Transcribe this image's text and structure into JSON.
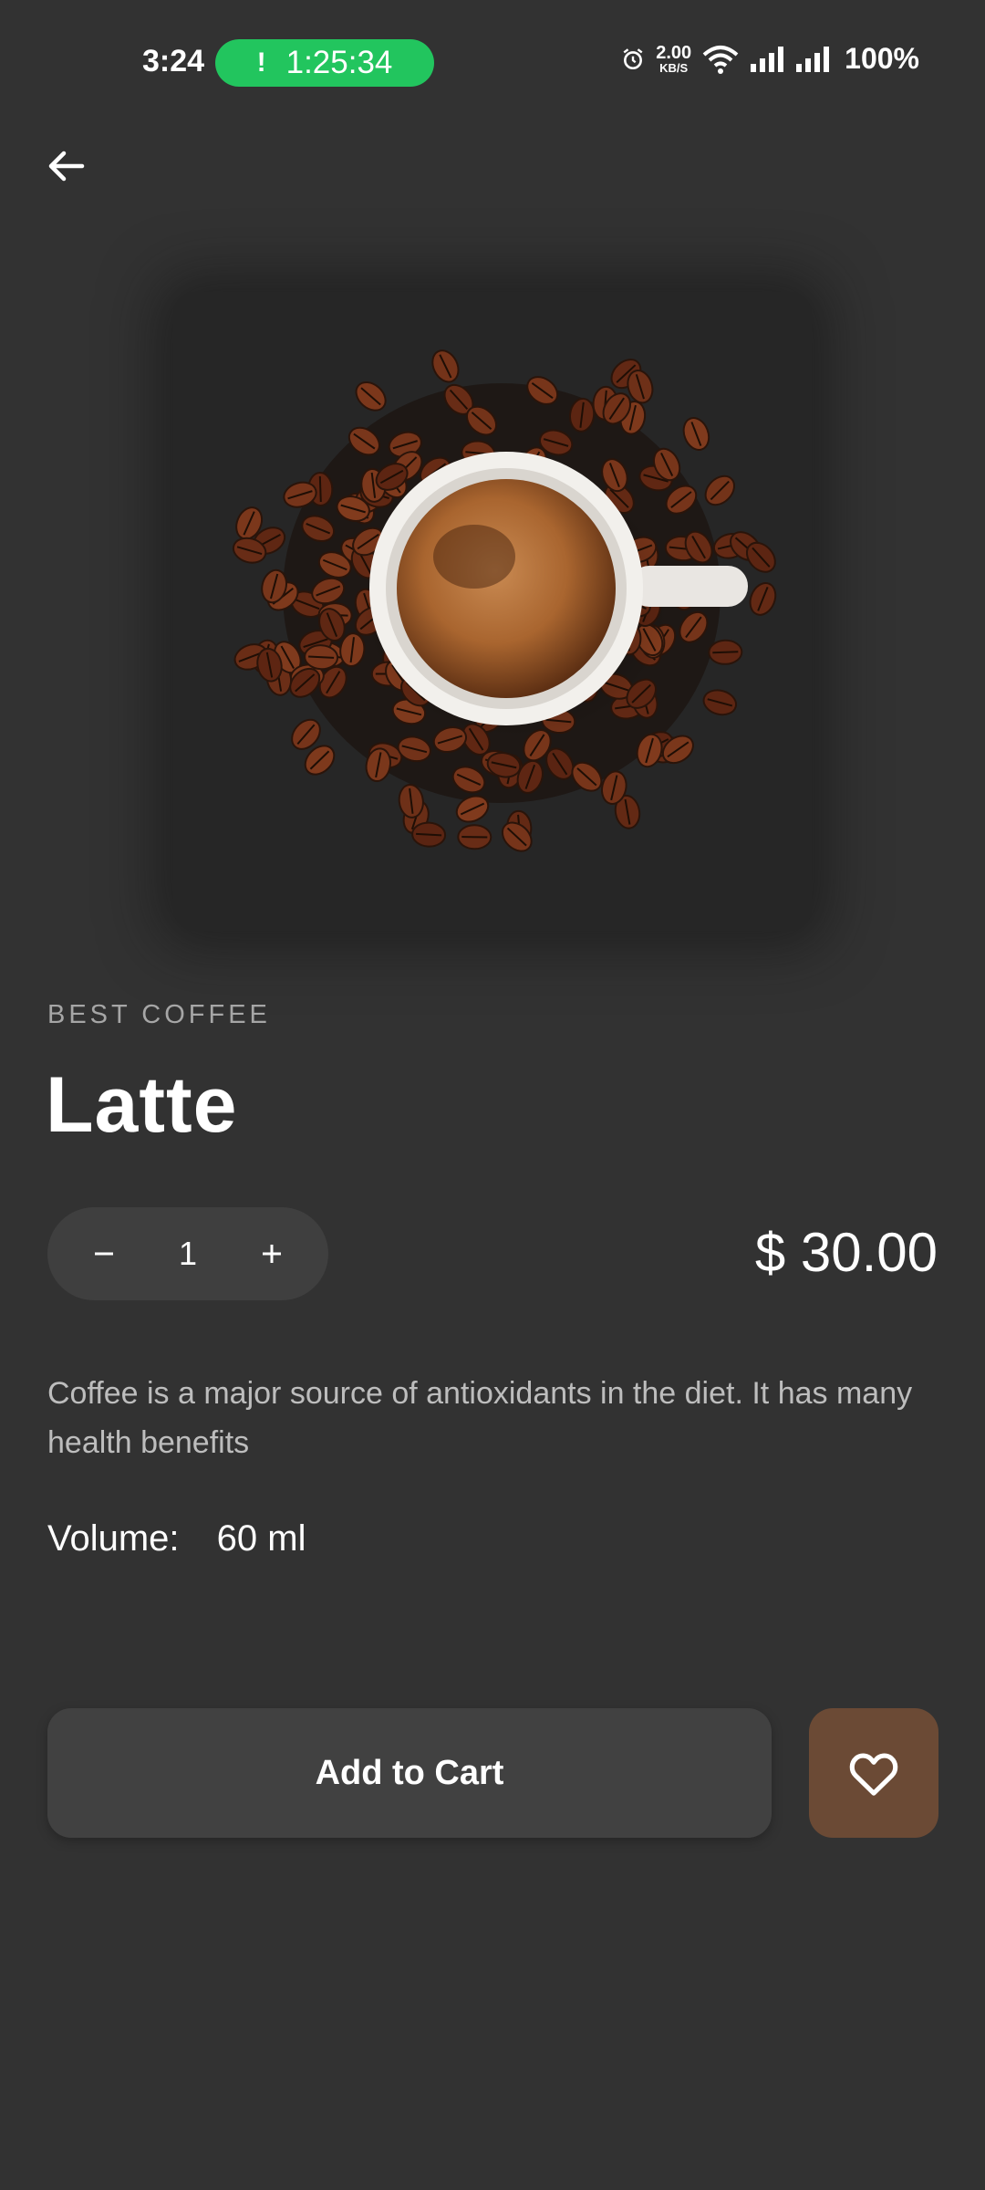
{
  "status_bar": {
    "time": "3:24",
    "call_timer": "1:25:34",
    "call_indicator": "!",
    "net_speed_value": "2.00",
    "net_speed_unit": "KB/S",
    "battery": "100%"
  },
  "nav": {
    "back_icon": "arrow-left-icon"
  },
  "product": {
    "category": "BEST COFFEE",
    "name": "Latte",
    "quantity": "1",
    "price": "$ 30.00",
    "description": "Coffee is a major source of antioxidants in the diet. It has many health benefits",
    "volume_label": "Volume:",
    "volume_value": "60 ml"
  },
  "actions": {
    "add_to_cart_label": "Add to Cart",
    "favorite_icon": "heart-icon"
  },
  "colors": {
    "background": "#323232",
    "surface": "#414141",
    "favorite": "#6b4a35",
    "call_pill": "#22c55e"
  }
}
